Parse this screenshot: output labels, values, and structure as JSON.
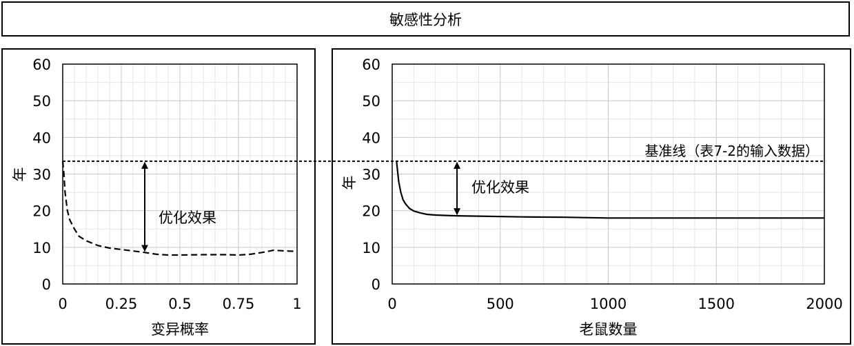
{
  "header": {
    "title": "敏感性分析"
  },
  "annotations": {
    "baseline_label": "基准线（表7-2的输入数据）",
    "left_effect_label": "优化效果",
    "right_effect_label": "优化效果"
  },
  "chart_data": [
    {
      "type": "line",
      "xlabel": "变异概率",
      "ylabel": "年",
      "xlim": [
        0,
        1
      ],
      "ylim": [
        0,
        60
      ],
      "x_ticks": [
        "0",
        "0.25",
        "0.5",
        "0.75",
        "1"
      ],
      "y_ticks": [
        "0",
        "10",
        "20",
        "30",
        "40",
        "50",
        "60"
      ],
      "grid": true,
      "series": [
        {
          "line_style": "dashed",
          "x": [
            0.0,
            0.005,
            0.01,
            0.02,
            0.03,
            0.05,
            0.07,
            0.1,
            0.15,
            0.2,
            0.25,
            0.3,
            0.35,
            0.4,
            0.45,
            0.5,
            0.6,
            0.7,
            0.75,
            0.8,
            0.85,
            0.9,
            0.95,
            1.0
          ],
          "y": [
            33.5,
            30,
            25,
            20,
            17.5,
            15,
            13,
            11.8,
            10.5,
            9.8,
            9.4,
            9.0,
            8.6,
            8.1,
            7.9,
            7.9,
            8.0,
            8.0,
            7.9,
            8.1,
            8.6,
            9.2,
            9.0,
            8.9
          ]
        }
      ],
      "baseline": 33.5,
      "effect_arrow": {
        "x": 0.35,
        "from": 33.5,
        "to": 8.6
      }
    },
    {
      "type": "line",
      "xlabel": "老鼠数量",
      "ylabel": "年",
      "xlim": [
        0,
        2000
      ],
      "ylim": [
        0,
        60
      ],
      "x_ticks": [
        "0",
        "500",
        "1000",
        "1500",
        "2000"
      ],
      "y_ticks": [
        "0",
        "10",
        "20",
        "30",
        "40",
        "50",
        "60"
      ],
      "grid": true,
      "series": [
        {
          "line_style": "solid",
          "x": [
            20,
            30,
            40,
            50,
            60,
            70,
            80,
            100,
            130,
            160,
            200,
            250,
            300,
            400,
            600,
            800,
            1000,
            1500,
            2000
          ],
          "y": [
            33.5,
            28,
            25,
            23,
            22,
            21.3,
            20.6,
            19.9,
            19.4,
            19.0,
            18.8,
            18.7,
            18.6,
            18.5,
            18.3,
            18.2,
            18.0,
            18.0,
            18.0
          ]
        }
      ],
      "baseline": 33.5,
      "effect_arrow": {
        "x": 300,
        "from": 33.5,
        "to": 18.6
      }
    }
  ]
}
